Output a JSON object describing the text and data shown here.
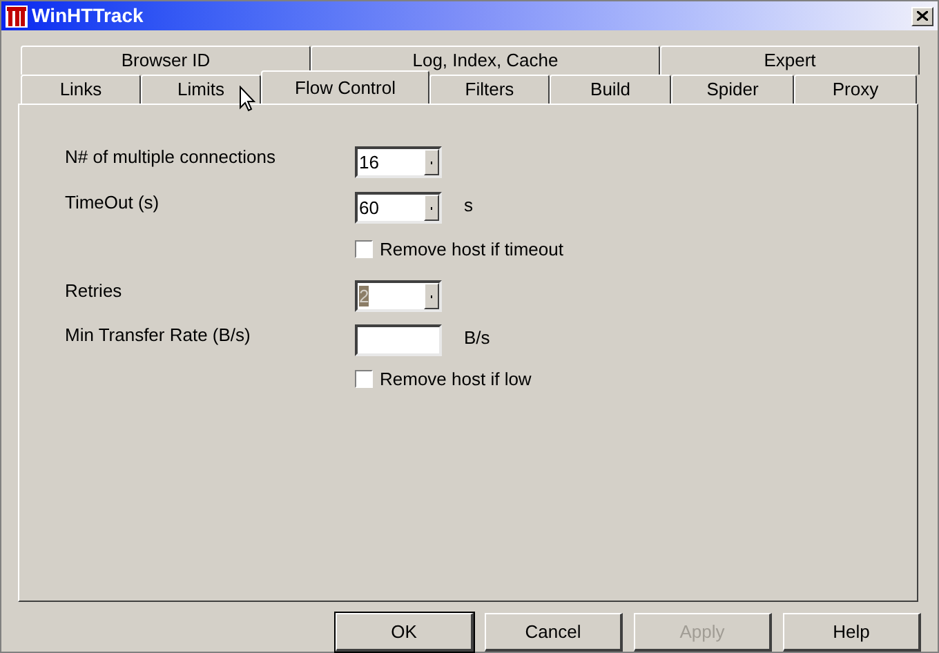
{
  "window": {
    "title": "WinHTTrack"
  },
  "tab_rows": [
    [
      {
        "label": "Browser ID",
        "selected": false
      },
      {
        "label": "Log, Index, Cache",
        "selected": false
      },
      {
        "label": "Expert",
        "selected": false
      }
    ],
    [
      {
        "label": "Links",
        "selected": false
      },
      {
        "label": "Limits",
        "selected": false
      },
      {
        "label": "Flow Control",
        "selected": true
      },
      {
        "label": "Filters",
        "selected": false
      },
      {
        "label": "Build",
        "selected": false
      },
      {
        "label": "Spider",
        "selected": false
      },
      {
        "label": "Proxy",
        "selected": false
      }
    ]
  ],
  "fields": [
    {
      "kind": "combo",
      "label": "N# of multiple connections",
      "value": "16",
      "value_selected": false
    },
    {
      "kind": "combo",
      "label": "TimeOut (s)",
      "value": "60",
      "value_selected": false,
      "unit": "s"
    },
    {
      "kind": "checkbox",
      "label": "Remove host if timeout",
      "checked": false
    },
    {
      "kind": "combo",
      "label": "Retries",
      "value": "2",
      "value_selected": true
    },
    {
      "kind": "text",
      "label": "Min Transfer Rate (B/s)",
      "unit": "B/s"
    },
    {
      "kind": "checkbox",
      "label": "Remove host if low",
      "checked": false
    }
  ],
  "buttons": [
    {
      "label": "OK",
      "default": true,
      "disabled": false
    },
    {
      "label": "Cancel",
      "default": false,
      "disabled": false
    },
    {
      "label": "Apply",
      "default": false,
      "disabled": true
    },
    {
      "label": "Help",
      "default": false,
      "disabled": false
    }
  ]
}
